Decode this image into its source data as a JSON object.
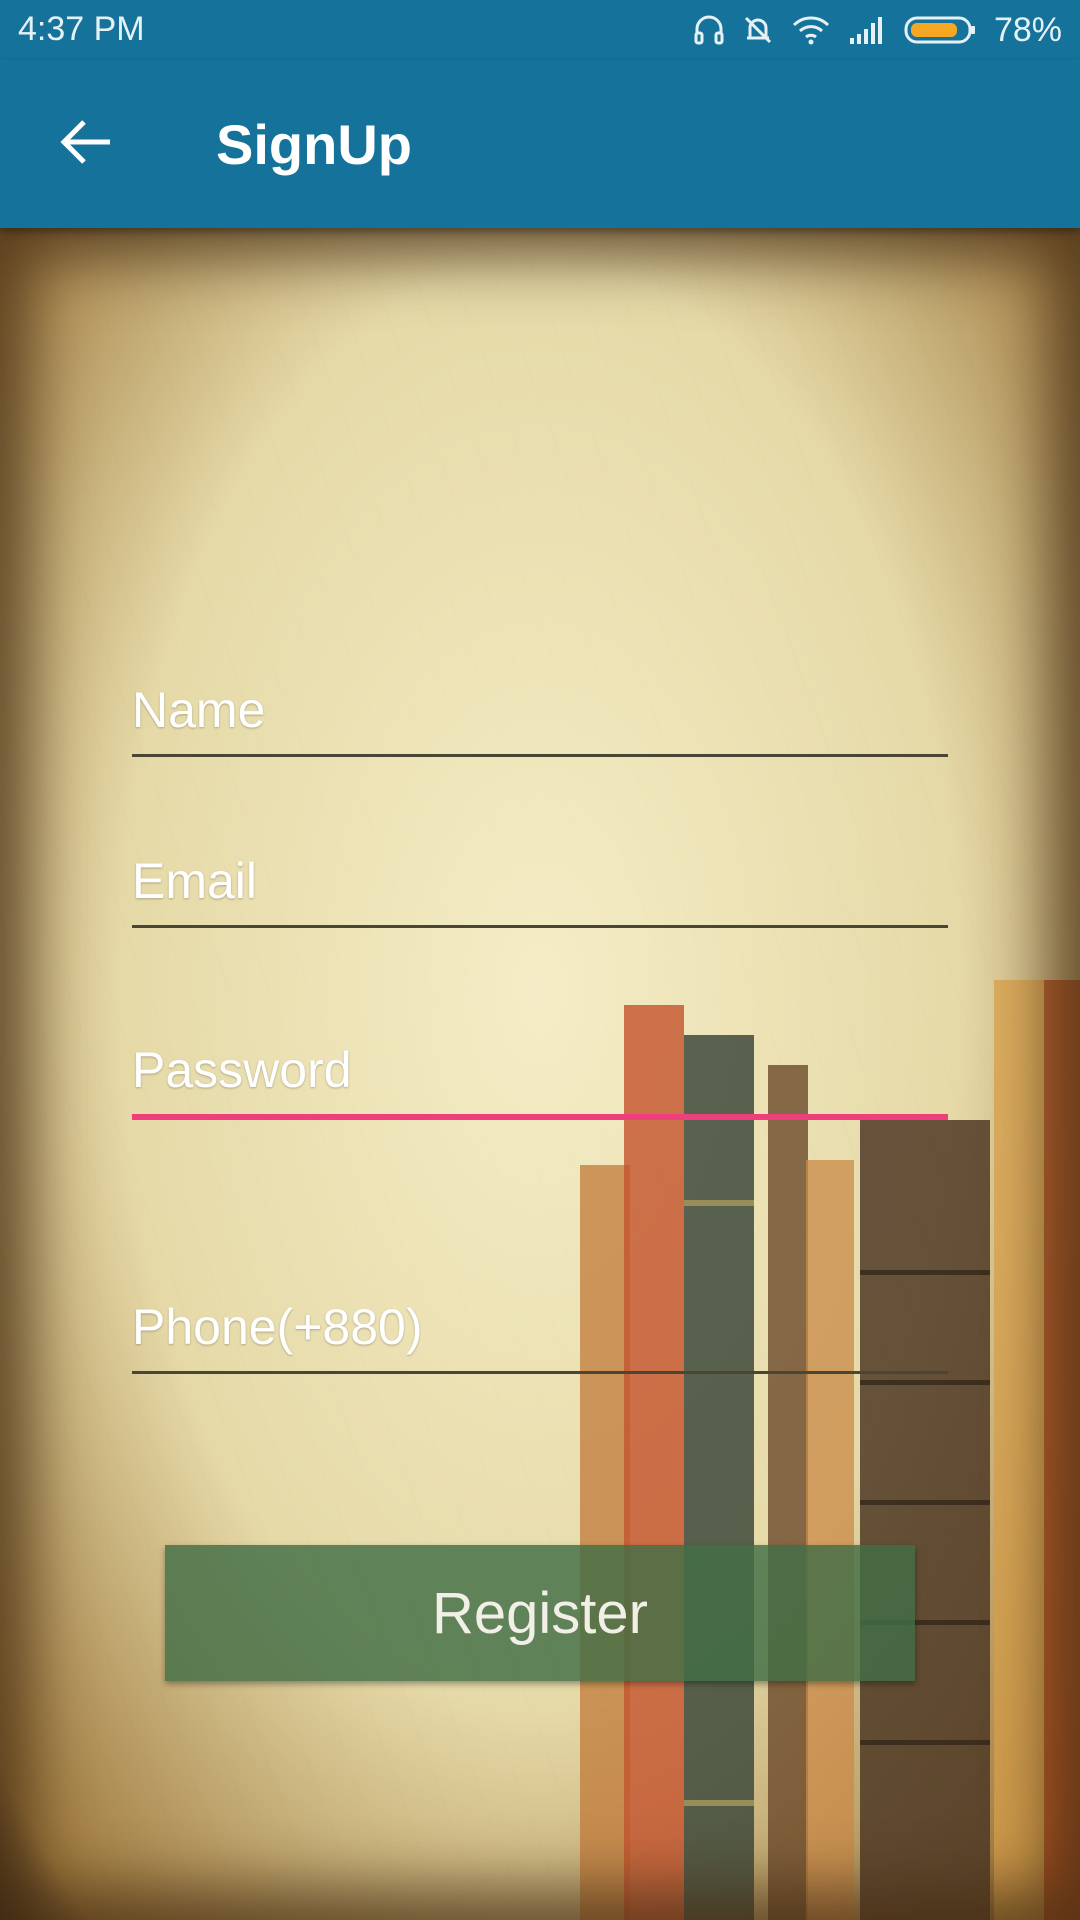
{
  "status_bar": {
    "time": "4:37 PM",
    "battery_percent": "78%",
    "icons": [
      "headset-icon",
      "alarm-off-icon",
      "wifi-icon",
      "signal-icon",
      "battery-icon"
    ]
  },
  "app_bar": {
    "title": "SignUp",
    "back_icon": "arrow-back-icon",
    "background_color": "#15739b"
  },
  "form": {
    "name_placeholder": "Name",
    "email_placeholder": "Email",
    "password_placeholder": "Password",
    "phone_placeholder": "Phone(+880)",
    "active_field": "password",
    "active_underline_color": "#ef3e7c",
    "register_label": "Register",
    "register_color": "#426e46"
  }
}
